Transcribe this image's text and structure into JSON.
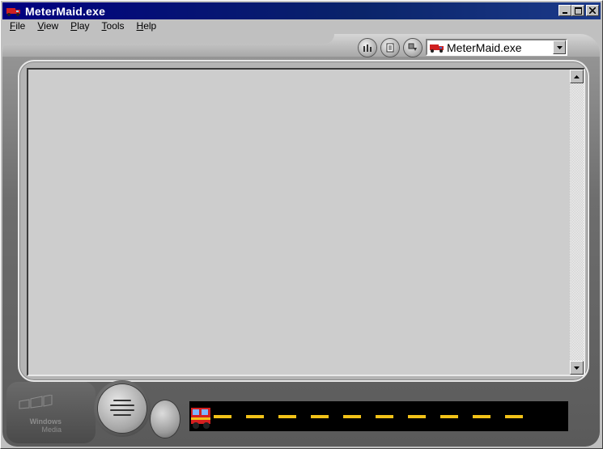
{
  "window": {
    "title": "MeterMaid.exe",
    "buttons": [
      "minimize",
      "maximize",
      "close"
    ]
  },
  "menu": {
    "items": [
      {
        "label": "File",
        "accel": "F",
        "rest": "ile"
      },
      {
        "label": "View",
        "accel": "V",
        "rest": "iew"
      },
      {
        "label": "Play",
        "accel": "P",
        "rest": "lay"
      },
      {
        "label": "Tools",
        "accel": "T",
        "rest": "ools"
      },
      {
        "label": "Help",
        "accel": "H",
        "rest": "elp"
      }
    ]
  },
  "toolbar": {
    "media_select_value": "MeterMaid.exe",
    "icons": [
      "equalizer-icon",
      "document-icon",
      "download-icon"
    ]
  },
  "branding": {
    "logo_line1": "Windows",
    "logo_line2": "Media"
  },
  "colors": {
    "titlebar": "#000080",
    "dash": "#f2c218",
    "track": "#000000"
  }
}
